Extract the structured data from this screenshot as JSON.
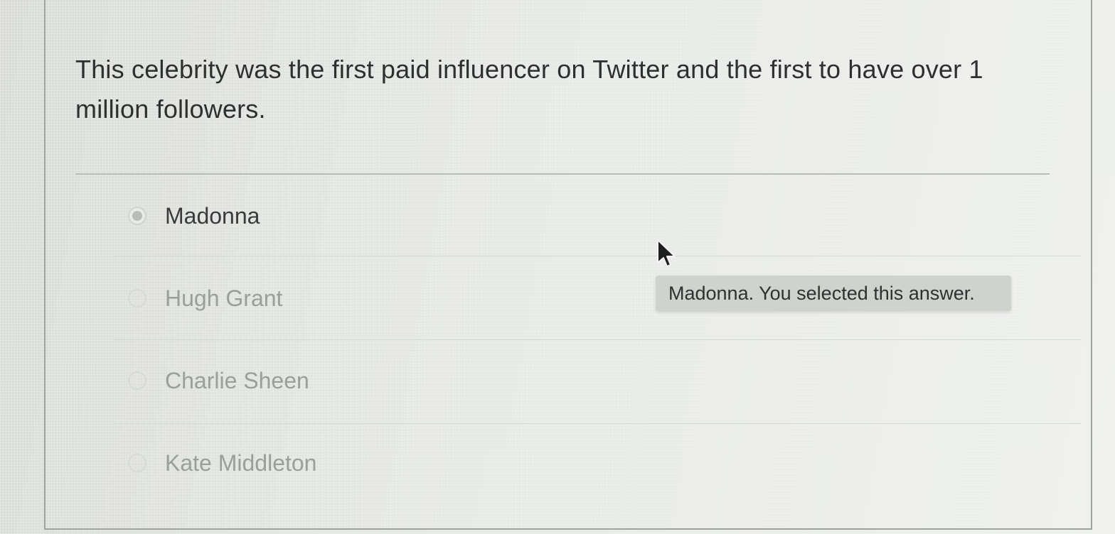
{
  "question": {
    "text": "This celebrity was the first paid influencer on Twitter and the first to have over 1 million followers."
  },
  "options": [
    {
      "label": "Madonna",
      "selected": true
    },
    {
      "label": "Hugh Grant",
      "selected": false
    },
    {
      "label": "Charlie Sheen",
      "selected": false
    },
    {
      "label": "Kate Middleton",
      "selected": false
    }
  ],
  "tooltip": {
    "text": "Madonna. You selected this answer."
  },
  "cursor": {
    "icon": "arrow-pointer-icon"
  }
}
